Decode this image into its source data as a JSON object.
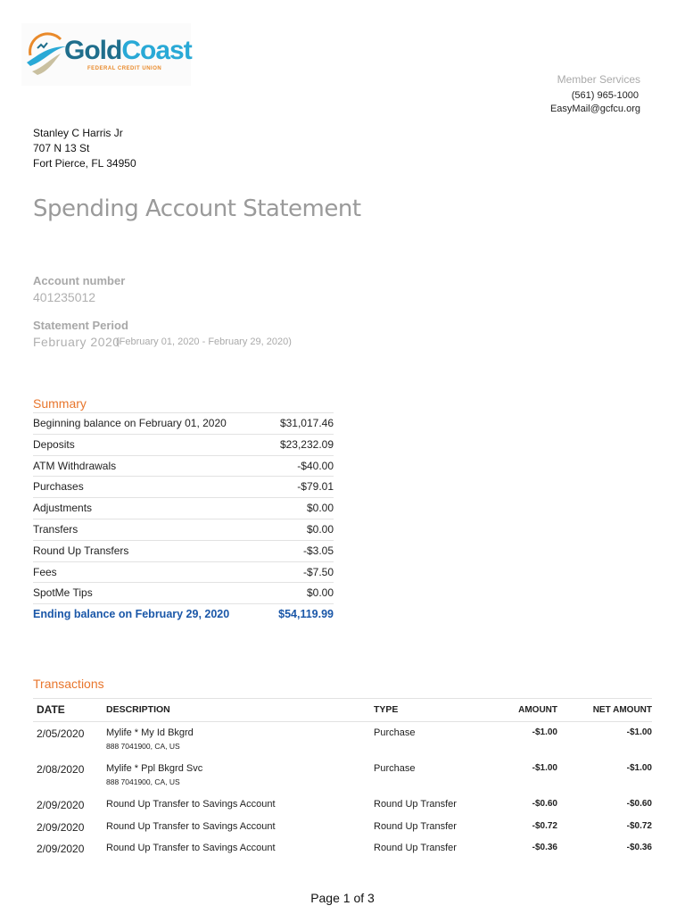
{
  "logo": {
    "text1": "Gold",
    "text2": "Coast",
    "sub": "FEDERAL CREDIT UNION"
  },
  "member_services": {
    "label": "Member Services",
    "phone": "(561) 965-1000",
    "email": "EasyMail@gcfcu.org"
  },
  "address": [
    "Stanley C Harris Jr",
    "707 N 13 St",
    "Fort Pierce, FL 34950"
  ],
  "title": "Spending Account Statement",
  "account": {
    "label": "Account number",
    "value": "401235012"
  },
  "period": {
    "label": "Statement Period",
    "month": "February 2020",
    "range": "(February 01, 2020 - February 29, 2020)"
  },
  "summary": {
    "heading": "Summary",
    "rows": [
      {
        "label": "Beginning balance on February 01, 2020",
        "value": "$31,017.46"
      },
      {
        "label": "Deposits",
        "value": "$23,232.09"
      },
      {
        "label": "ATM Withdrawals",
        "value": "-$40.00"
      },
      {
        "label": "Purchases",
        "value": "-$79.01"
      },
      {
        "label": "Adjustments",
        "value": "$0.00"
      },
      {
        "label": "Transfers",
        "value": "$0.00"
      },
      {
        "label": "Round Up Transfers",
        "value": "-$3.05"
      },
      {
        "label": "Fees",
        "value": "-$7.50"
      },
      {
        "label": "SpotMe Tips",
        "value": "$0.00"
      }
    ],
    "ending": {
      "label": "Ending balance on February 29, 2020",
      "value": "$54,119.99"
    }
  },
  "transactions": {
    "heading": "Transactions",
    "columns": [
      "DATE",
      "DESCRIPTION",
      "TYPE",
      "AMOUNT",
      "NET AMOUNT"
    ],
    "rows": [
      {
        "date": "2/05/2020",
        "desc": "Mylife * My Id Bkgrd",
        "sub": "888 7041900, CA, US",
        "type": "Purchase",
        "amount": "-$1.00",
        "net": "-$1.00"
      },
      {
        "date": "2/08/2020",
        "desc": "Mylife * Ppl Bkgrd Svc",
        "sub": "888 7041900, CA, US",
        "type": "Purchase",
        "amount": "-$1.00",
        "net": "-$1.00"
      },
      {
        "date": "2/09/2020",
        "desc": "Round Up Transfer to Savings Account",
        "sub": "",
        "type": "Round Up Transfer",
        "amount": "-$0.60",
        "net": "-$0.60"
      },
      {
        "date": "2/09/2020",
        "desc": "Round Up Transfer to Savings Account",
        "sub": "",
        "type": "Round Up Transfer",
        "amount": "-$0.72",
        "net": "-$0.72"
      },
      {
        "date": "2/09/2020",
        "desc": "Round Up Transfer to Savings Account",
        "sub": "",
        "type": "Round Up Transfer",
        "amount": "-$0.36",
        "net": "-$0.36"
      }
    ]
  },
  "footer": "Page 1 of 3"
}
